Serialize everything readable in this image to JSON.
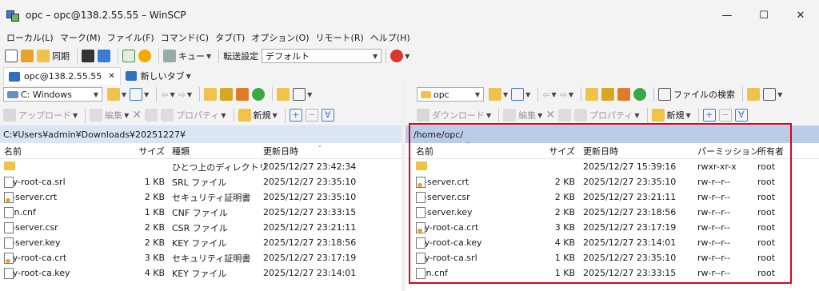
{
  "window": {
    "title": "opc – opc@138.2.55.55 – WinSCP",
    "minimize": "—",
    "maximize": "☐",
    "close": "✕"
  },
  "menu": [
    "ローカル(L)",
    "マーク(M)",
    "ファイル(F)",
    "コマンド(C)",
    "タブ(T)",
    "オプション(O)",
    "リモート(R)",
    "ヘルプ(H)"
  ],
  "toolbar": {
    "sync_label": "同期",
    "queue_label": "キュー",
    "transfer_settings_label": "転送設定",
    "transfer_preset": "デフォルト"
  },
  "tabs": {
    "session": "opc@138.2.55.55",
    "close": "✕",
    "new_tab": "新しいタブ"
  },
  "left": {
    "drive": "C: Windows",
    "upload": "アップロード",
    "edit": "編集",
    "properties": "プロパティ",
    "new": "新規",
    "path": "C:¥Users¥admin¥Downloads¥20251227¥",
    "columns": {
      "name": "名前",
      "size": "サイズ",
      "type": "種類",
      "modified": "更新日時"
    },
    "files": [
      {
        "name": "..",
        "size": "",
        "type": "ひとつ上のディレクトリ",
        "modified": "2025/12/27 23:42:34",
        "icon": "up"
      },
      {
        "name": "my-root-ca.srl",
        "size": "1 KB",
        "type": "SRL ファイル",
        "modified": "2025/12/27 23:35:10",
        "icon": "file"
      },
      {
        "name": "lb-server.crt",
        "size": "2 KB",
        "type": "セキュリティ証明書",
        "modified": "2025/12/27 23:35:10",
        "icon": "cert"
      },
      {
        "name": "san.cnf",
        "size": "1 KB",
        "type": "CNF ファイル",
        "modified": "2025/12/27 23:33:15",
        "icon": "file"
      },
      {
        "name": "lb-server.csr",
        "size": "2 KB",
        "type": "CSR ファイル",
        "modified": "2025/12/27 23:21:11",
        "icon": "file"
      },
      {
        "name": "lb-server.key",
        "size": "2 KB",
        "type": "KEY ファイル",
        "modified": "2025/12/27 23:18:56",
        "icon": "file"
      },
      {
        "name": "my-root-ca.crt",
        "size": "3 KB",
        "type": "セキュリティ証明書",
        "modified": "2025/12/27 23:17:19",
        "icon": "cert"
      },
      {
        "name": "my-root-ca.key",
        "size": "4 KB",
        "type": "KEY ファイル",
        "modified": "2025/12/27 23:14:01",
        "icon": "file"
      }
    ]
  },
  "right": {
    "dir": "opc",
    "download": "ダウンロード",
    "edit": "編集",
    "properties": "プロパティ",
    "new": "新規",
    "find": "ファイルの検索",
    "path": "/home/opc/",
    "columns": {
      "name": "名前",
      "size": "サイズ",
      "modified": "更新日時",
      "permissions": "パーミッション",
      "owner": "所有者"
    },
    "files": [
      {
        "name": "..",
        "size": "",
        "modified": "2025/12/27 15:39:16",
        "permissions": "rwxr-xr-x",
        "owner": "root",
        "icon": "up"
      },
      {
        "name": "lb-server.crt",
        "size": "2 KB",
        "modified": "2025/12/27 23:35:10",
        "permissions": "rw-r--r--",
        "owner": "root",
        "icon": "cert"
      },
      {
        "name": "lb-server.csr",
        "size": "2 KB",
        "modified": "2025/12/27 23:21:11",
        "permissions": "rw-r--r--",
        "owner": "root",
        "icon": "file"
      },
      {
        "name": "lb-server.key",
        "size": "2 KB",
        "modified": "2025/12/27 23:18:56",
        "permissions": "rw-r--r--",
        "owner": "root",
        "icon": "file"
      },
      {
        "name": "my-root-ca.crt",
        "size": "3 KB",
        "modified": "2025/12/27 23:17:19",
        "permissions": "rw-r--r--",
        "owner": "root",
        "icon": "cert"
      },
      {
        "name": "my-root-ca.key",
        "size": "4 KB",
        "modified": "2025/12/27 23:14:01",
        "permissions": "rw-r--r--",
        "owner": "root",
        "icon": "file"
      },
      {
        "name": "my-root-ca.srl",
        "size": "1 KB",
        "modified": "2025/12/27 23:35:10",
        "permissions": "rw-r--r--",
        "owner": "root",
        "icon": "file"
      },
      {
        "name": "san.cnf",
        "size": "1 KB",
        "modified": "2025/12/27 23:33:15",
        "permissions": "rw-r--r--",
        "owner": "root",
        "icon": "file"
      }
    ]
  },
  "colors": {
    "highlight": "#e0001b",
    "left_path_bg": "#d9e5f3",
    "right_path_bg": "#b9cde8",
    "folder": "#f0c24b"
  }
}
